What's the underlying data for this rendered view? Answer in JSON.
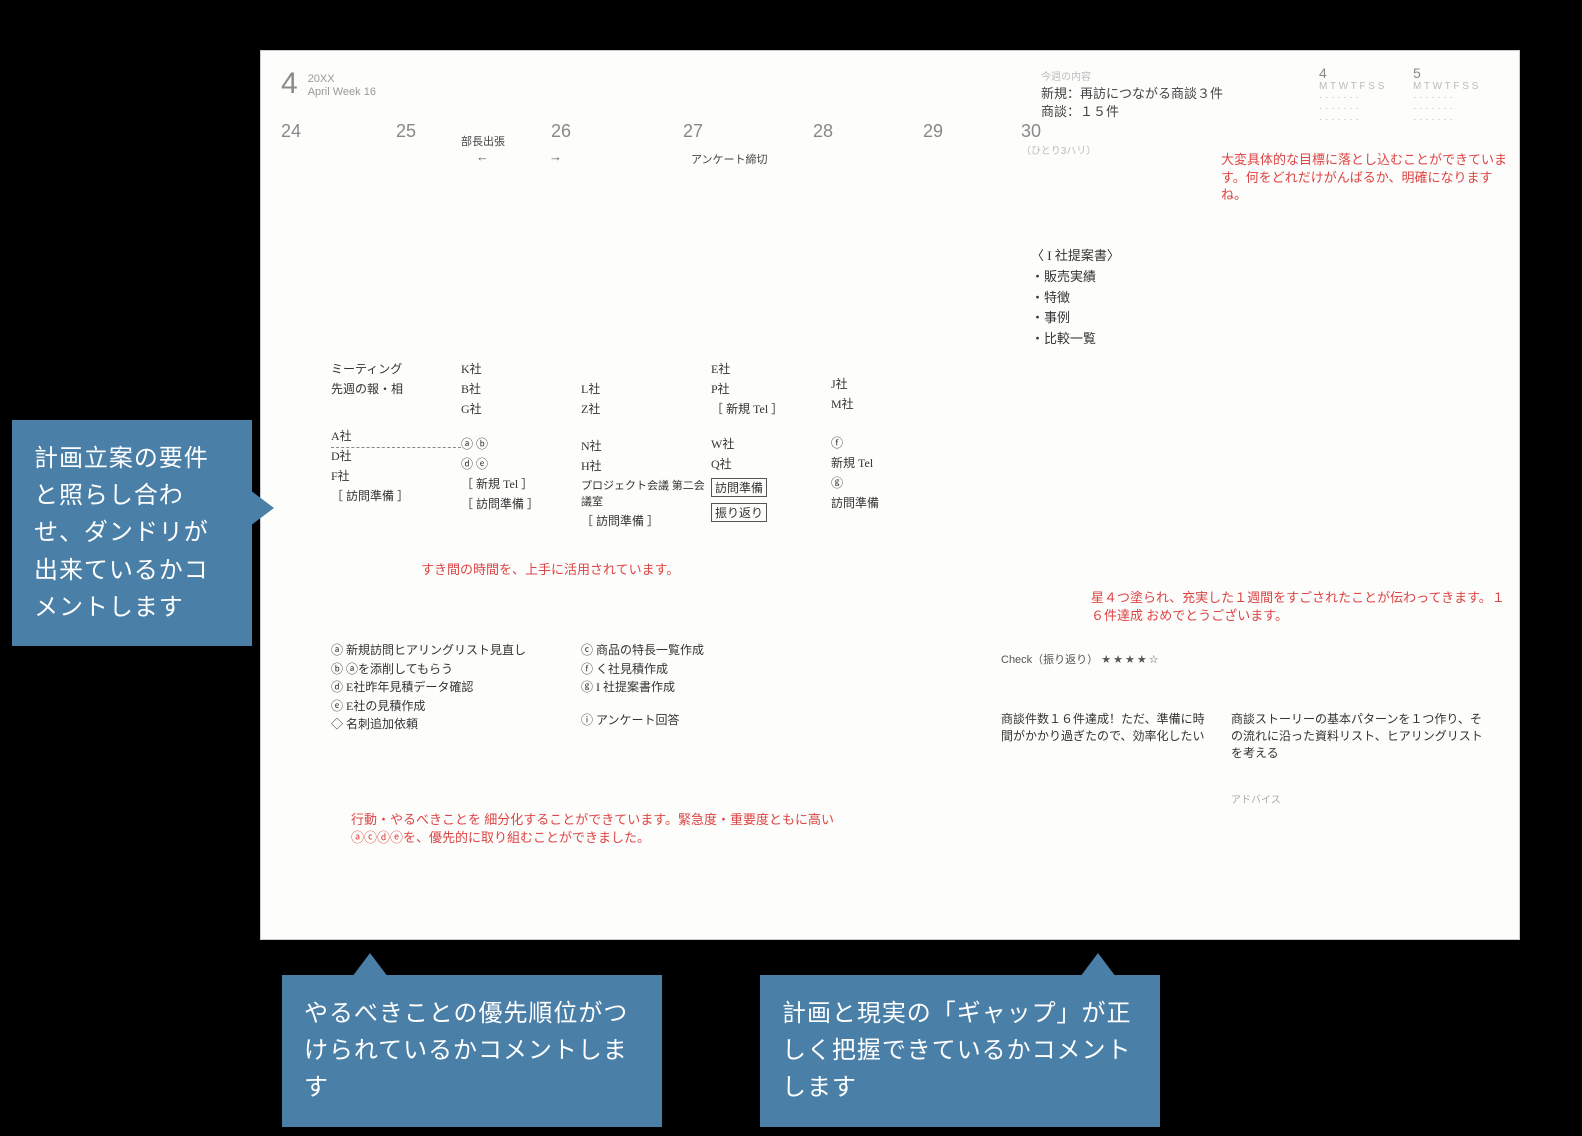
{
  "header": {
    "month_number": "4",
    "year": "20XX",
    "month_label": "April  Week 16"
  },
  "week_goal_label": "今週の内容",
  "week_goals": {
    "line1": "新規：再訪につながる商談３件",
    "line2": "商談：１５件"
  },
  "mini_calendars": {
    "left": "4",
    "right": "5"
  },
  "days": {
    "d24": "24",
    "d25": "25",
    "d26": "26",
    "d27": "27",
    "d28": "28",
    "d29": "29",
    "d30": "30",
    "d30_sub": "（ひとり3ハリ）"
  },
  "day_notes": {
    "d25_26": "部長出張",
    "d27": "アンケート締切"
  },
  "schedule": {
    "mon": [
      "ミーティング",
      "先週の報・相",
      "A社",
      "D社",
      "F社",
      "［ 訪問準備 ］"
    ],
    "tue": [
      "K社",
      "B社",
      "G社",
      "ⓐ ⓑ",
      "ⓓ ⓔ",
      "［ 新規 Tel ］",
      "［ 訪問準備 ］"
    ],
    "wed": [
      "L社",
      "Z社",
      "N社",
      "H社",
      "プロジェクト会議 第二会議室",
      "［ 訪問準備 ］"
    ],
    "thu": [
      "E社",
      "P社",
      "［ 新規 Tel ］",
      "W社",
      "Q社",
      "訪問準備",
      "振り返り"
    ],
    "fri": [
      "J社",
      "M社",
      "ⓕ",
      "新規 Tel",
      "ⓖ",
      "訪問準備"
    ]
  },
  "proposal": {
    "title": "〈 I 社提案書〉",
    "items": [
      "・販売実績",
      "・特徴",
      "・事例",
      "・比較一覧"
    ]
  },
  "red_comments": {
    "top": "大変具体的な目標に落とし込むことができています。何をどれだけがんばるか、明確になりますね。",
    "mid": "すき間の時間を、上手に活用されています。",
    "stars": "星４つ塗られ、充実した１週間をすごされたことが伝わってきます。１６件達成 おめでとうございます。",
    "bottom": "行動・やるべきことを 細分化することができています。緊急度・重要度ともに高い ⓐⓒⓓⓔを、優先的に取り組むことができました。"
  },
  "tasks": {
    "left": [
      "ⓐ 新規訪問ヒアリングリスト見直し",
      "ⓑ ⓐを添削してもらう",
      "ⓓ E社昨年見積データ確認",
      "ⓔ E社の見積作成",
      "◇ 名刺追加依頼"
    ],
    "right": [
      "ⓒ 商品の特長一覧作成",
      "ⓕ く社見積作成",
      "ⓖ I 社提案書作成",
      "ⓘ アンケート回答"
    ]
  },
  "check": {
    "label": "Check（振り返り）",
    "stars": "★★★★☆"
  },
  "review": {
    "left": "商談件数１６件達成！ただ、準備に時間がかかり過ぎたので、効率化したい",
    "right": "商談ストーリーの基本パターンを１つ作り、その流れに沿った資料リスト、ヒアリングリストを考える",
    "advice_label": "アドバイス"
  },
  "callouts": {
    "left": "計画立案の要件と照らし合わせ、ダンドリが出来ているかコメントします",
    "bottom1": "やるべきことの優先順位がつけられているかコメントします",
    "bottom2": "計画と現実の「ギャップ」が正しく把握できているかコメントします"
  }
}
